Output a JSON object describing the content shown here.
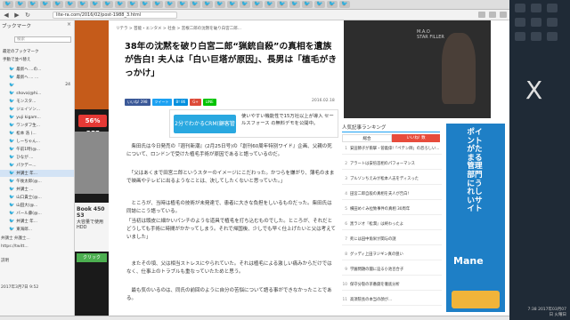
{
  "browser": {
    "url": "lite-ra.com/2016/02/post-1988_3.html",
    "tab_icon": "twitter-bird-icon",
    "tab_count": 28
  },
  "sidebar": {
    "title": "ブックマーク",
    "close": "×",
    "search_placeholder": "検索",
    "section_recent": "最近のブックマーク",
    "section_folder": "手動で並べ替え",
    "items": [
      {
        "label": "最新へ ...の...",
        "count": ""
      },
      {
        "label": "最新へ ... ...",
        "count": ""
      },
      {
        "label": "",
        "count": "24"
      },
      {
        "label": "shova(@hi...",
        "count": ""
      },
      {
        "label": "モンスタ...",
        "count": ""
      },
      {
        "label": "ジェイソン...",
        "count": ""
      },
      {
        "label": "yuji kigam...",
        "count": ""
      },
      {
        "label": "ワンダフ生...",
        "count": ""
      },
      {
        "label": "松本 浩 (...",
        "count": ""
      },
      {
        "label": "しーちゃん...",
        "count": ""
      },
      {
        "label": "午前1時(@...",
        "count": ""
      },
      {
        "label": "ひなが ...",
        "count": ""
      },
      {
        "label": "パクデー...",
        "count": ""
      },
      {
        "label": "井講士 年...",
        "count": ""
      },
      {
        "label": "午後太郎(@...",
        "count": ""
      },
      {
        "label": "井講士 ...",
        "count": ""
      },
      {
        "label": "山口貴士(@...",
        "count": ""
      },
      {
        "label": "山田大(@...",
        "count": ""
      },
      {
        "label": "バール藤(@...",
        "count": ""
      },
      {
        "label": "井講士 年...",
        "count": ""
      },
      {
        "label": "東海郎...",
        "count": ""
      }
    ],
    "footer_name": "井講士 弁護士...",
    "footer_url": "https://twitt...",
    "footer_desc_label": "説明",
    "footer_time": "2017年3月7日 9:52"
  },
  "article": {
    "breadcrumb": "リテラ > 芸能・エンタメ > 社会 > 宮根二郎の沈黙を破り白宮二郎...",
    "headline": "38年の沈黙を破り白宮二郎“猟銃自殺”の真相を遺族が告白! 夫人は「白い巨塔が原因」、長男は「植毛がきっかけ」",
    "share": [
      {
        "label": "いいね! 298",
        "color": "#3b5998"
      },
      {
        "label": "ツイート",
        "color": "#1da1f2"
      },
      {
        "label": "B! 86",
        "color": "#008fde"
      },
      {
        "label": "G+",
        "color": "#dd4b39"
      },
      {
        "label": "LINE",
        "color": "#00c300"
      }
    ],
    "date": "2016.02.18",
    "ad_button": "2分でわかるCRM(顧客管理)",
    "ad_text": "使いやすい機能性で15万社以上が導入 セールスフォース の無料デモを公開中。",
    "paragraphs": [
      "　柴田氏は今日発売の『週刊新潮』(2月25日号)の『創刊60周年特別ワイド』企画、父親の死について、ロンドンで受けた植毛手術が原因であると語っているのだ。",
      "　「父はあくまで田宮二郎というスターのイメージにこだわった。かつらを嫌がり、薄毛のままで映画やテレビに出るようなことは、決してしたくないと思っていた。」",
      "　ところが、当時は植毛の技術が未発達で、患者に大きな負担をしいるものだった。柴田氏は同誌にこう語っている。",
      "「当初は頭皮に細かいパンチのような道具で植毛を打ち込むものでした。ところが、それだとどうしても手術に時間がかかってしまう。それで帰国後、少しでも早く仕上げたいと父は考えていました」",
      "　またその頃、父は相当ストレスにやられていた。それは植毛による激しい痛みからだけではなく、仕事上のトラブルも重なっていたためと思う。",
      "　最も気のいるのは、同氏の前回のように自分の苦悩について語る事ができなかったことである。"
    ]
  },
  "left_ad": {
    "badge": "56% OFF",
    "lines": [
      "Book 450 S3",
      "大容量で使用",
      "HDD",
      "クリック"
    ]
  },
  "right_ad": {
    "brand": "M.A.O",
    "sub": "STAR FILLER"
  },
  "ranking": {
    "title": "人気記事ランキング",
    "tabs": [
      "総合",
      "いいね! 数"
    ],
    "items": [
      "安田節子が衝撃・菅義偉!「ペテン師」の恐ろしい...",
      "アラートは安倍首相のパフォーマンス",
      "ブルゾンちえみが松本人志をディスった",
      "田宮二郎自殺の真相を夫人が告白!",
      "横田めぐみ拉致事件の真相 30周年",
      "黒ラジオ『松潤』は終わったよ",
      "死には田中角栄が関与の謎",
      "グッディ上田ヲジギン真の狙い",
      "学園問題の闇に迫る小池百合子",
      "保守分裂の茶番劇を徹底分析",
      "高須院長の本当の顔が..."
    ]
  },
  "mane": {
    "headline": "ポイントがたまる管理部門にうれしいサイト",
    "logo": "Mane"
  },
  "desktop": {
    "big_letter": "X",
    "clock": "7:38 2017年03月07日 火曜日"
  }
}
